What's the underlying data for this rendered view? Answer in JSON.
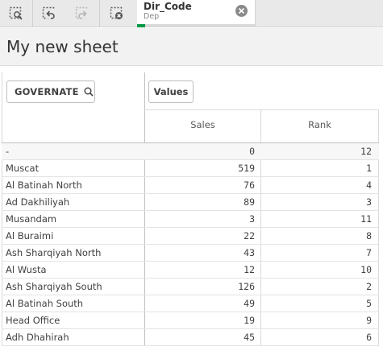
{
  "toolbar": {
    "buttons": [
      {
        "name": "smart-search-button",
        "icon": "selection-lasso-search-icon"
      },
      {
        "name": "step-back-button",
        "icon": "step-back-icon"
      },
      {
        "name": "step-forward-button",
        "icon": "step-forward-icon"
      },
      {
        "name": "clear-all-selections-button",
        "icon": "clear-selections-icon"
      }
    ]
  },
  "selection": {
    "field": "Dir_Code",
    "value": "Dep",
    "accent_color": "#009845"
  },
  "sheet": {
    "title": "My new sheet"
  },
  "pivot": {
    "dimension_label": "GOVERNATE",
    "values_label": "Values",
    "columns": [
      "Sales",
      "Rank"
    ],
    "rows": [
      {
        "name": "-",
        "sales": "0",
        "rank": "12"
      },
      {
        "name": "Muscat",
        "sales": "519",
        "rank": "1"
      },
      {
        "name": "Al Batinah North",
        "sales": "76",
        "rank": "4"
      },
      {
        "name": "Ad Dakhiliyah",
        "sales": "89",
        "rank": "3"
      },
      {
        "name": "Musandam",
        "sales": "3",
        "rank": "11"
      },
      {
        "name": "Al Buraimi",
        "sales": "22",
        "rank": "8"
      },
      {
        "name": "Ash Sharqiyah North",
        "sales": "43",
        "rank": "7"
      },
      {
        "name": "Al Wusta",
        "sales": "12",
        "rank": "10"
      },
      {
        "name": "Ash Sharqiyah South",
        "sales": "126",
        "rank": "2"
      },
      {
        "name": "Al Batinah South",
        "sales": "49",
        "rank": "5"
      },
      {
        "name": "Head Office",
        "sales": "19",
        "rank": "9"
      },
      {
        "name": "Adh Dhahirah",
        "sales": "45",
        "rank": "6"
      }
    ]
  }
}
